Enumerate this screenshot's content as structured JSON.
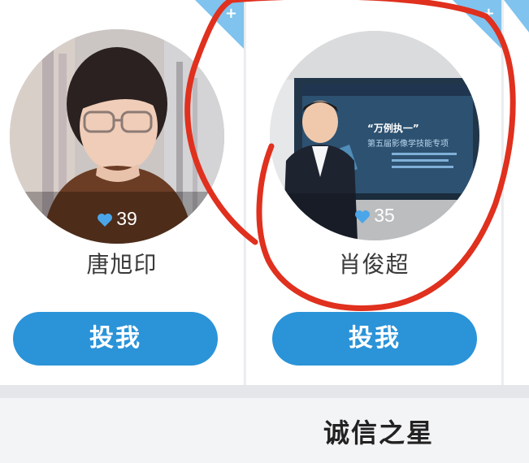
{
  "candidates": [
    {
      "name": "唐旭印",
      "likes": "39",
      "vote_label": "投我",
      "corner_icon": "plus-icon",
      "heart_icon": "heart-icon"
    },
    {
      "name": "肖俊超",
      "likes": "35",
      "vote_label": "投我",
      "corner_icon": "plus-icon",
      "heart_icon": "heart-icon",
      "banner_text": "“万例执一”",
      "banner_subtext": "第五届影像学技能专项"
    }
  ],
  "section": {
    "title": "诚信之星"
  },
  "colors": {
    "accent": "#2b93d8",
    "corner": "#7fc3ee",
    "annotation": "#e0301e"
  }
}
